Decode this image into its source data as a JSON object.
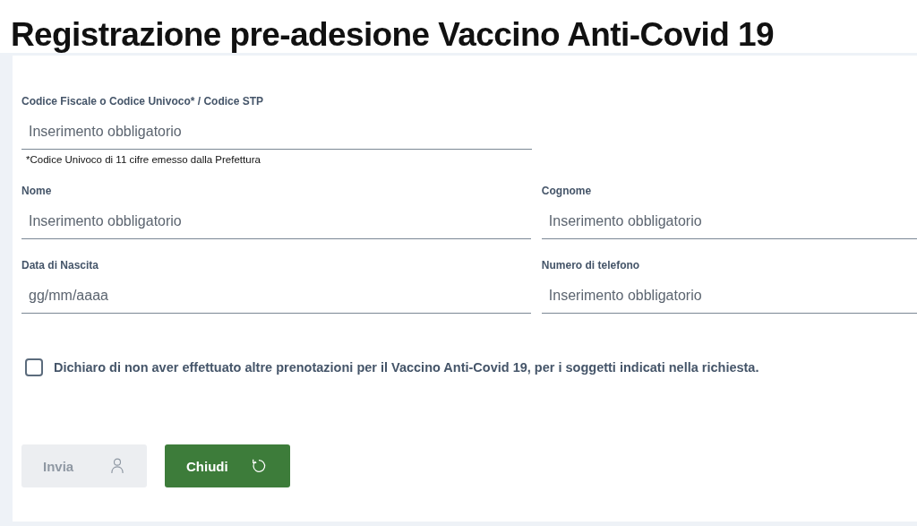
{
  "title": "Registrazione pre-adesione Vaccino Anti-Covid 19",
  "form": {
    "rows": [
      {
        "fields": [
          {
            "label": "Codice Fiscale o Codice Univoco* / Codice STP",
            "placeholder": "Inserimento obbligatorio",
            "hint": "*Codice Univoco di 11 cifre emesso dalla Prefettura"
          }
        ]
      },
      {
        "fields": [
          {
            "label": "Nome",
            "placeholder": "Inserimento obbligatorio"
          },
          {
            "label": "Cognome",
            "placeholder": "Inserimento obbligatorio"
          }
        ]
      },
      {
        "fields": [
          {
            "label": "Data di Nascita",
            "placeholder": "gg/mm/aaaa"
          },
          {
            "label": "Numero di telefono",
            "placeholder": "Inserimento obbligatorio"
          }
        ]
      }
    ],
    "declaration": {
      "label": "Dichiaro di non aver effettuato altre prenotazioni per il Vaccino Anti-Covid 19, per i soggetti indicati nella richiesta.",
      "checked": false
    },
    "buttons": [
      {
        "label": "Invia",
        "disabled": true
      },
      {
        "label": "Chiudi",
        "disabled": false
      }
    ]
  }
}
